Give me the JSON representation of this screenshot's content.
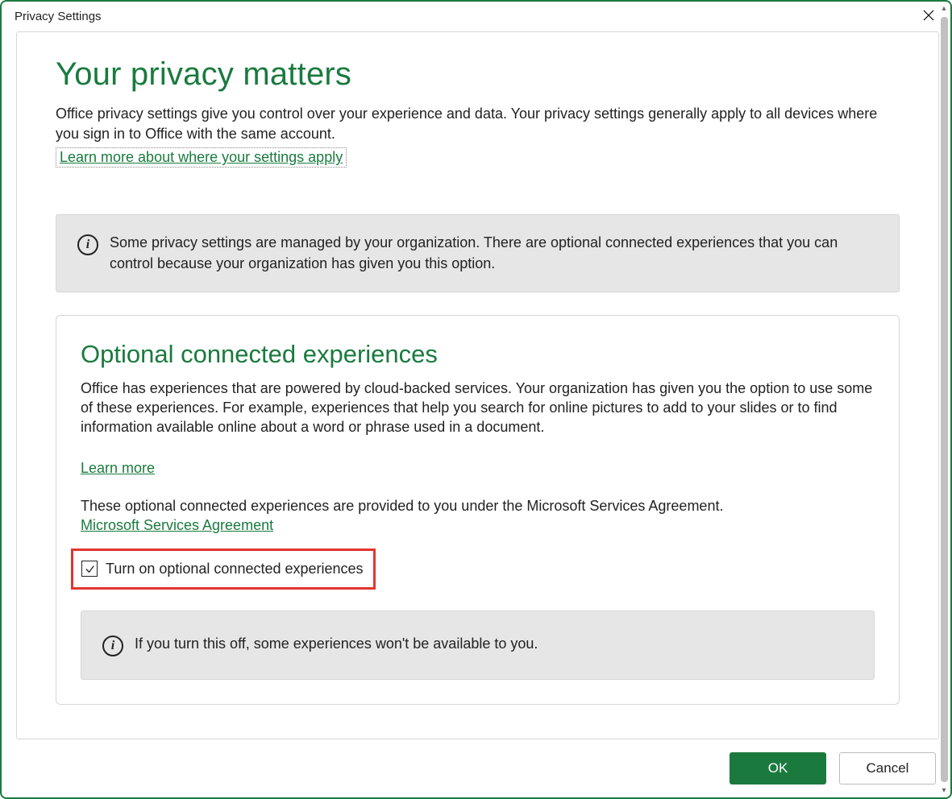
{
  "dialog": {
    "title": "Privacy Settings",
    "close_icon": "✕"
  },
  "main": {
    "heading": "Your privacy matters",
    "intro": "Office privacy settings give you control over your experience and data. Your privacy settings generally apply to all devices where you sign in to Office with the same account.",
    "learn_more_link": "Learn more about where your settings apply"
  },
  "org_notice": {
    "text": "Some privacy settings are managed by your organization. There are optional connected experiences that you can control because your organization has given you this option."
  },
  "optional": {
    "heading": "Optional connected experiences",
    "body": "Office has experiences that are powered by cloud-backed services. Your organization has given you the option to use some of these experiences. For example, experiences that help you search for online pictures to add to your slides or to find information available online about a word or phrase used in a document.",
    "learn_more_link": "Learn more",
    "agreement_intro": "These optional connected experiences are provided to you under the Microsoft Services Agreement.",
    "agreement_link": "Microsoft Services Agreement",
    "checkbox_label": "Turn on optional connected experiences",
    "checkbox_checked": true,
    "off_notice": "If you turn this off, some experiences won't be available to you."
  },
  "footer": {
    "ok_label": "OK",
    "cancel_label": "Cancel"
  },
  "colors": {
    "accent": "#1a7a3e",
    "highlight_border": "#e3352e"
  }
}
